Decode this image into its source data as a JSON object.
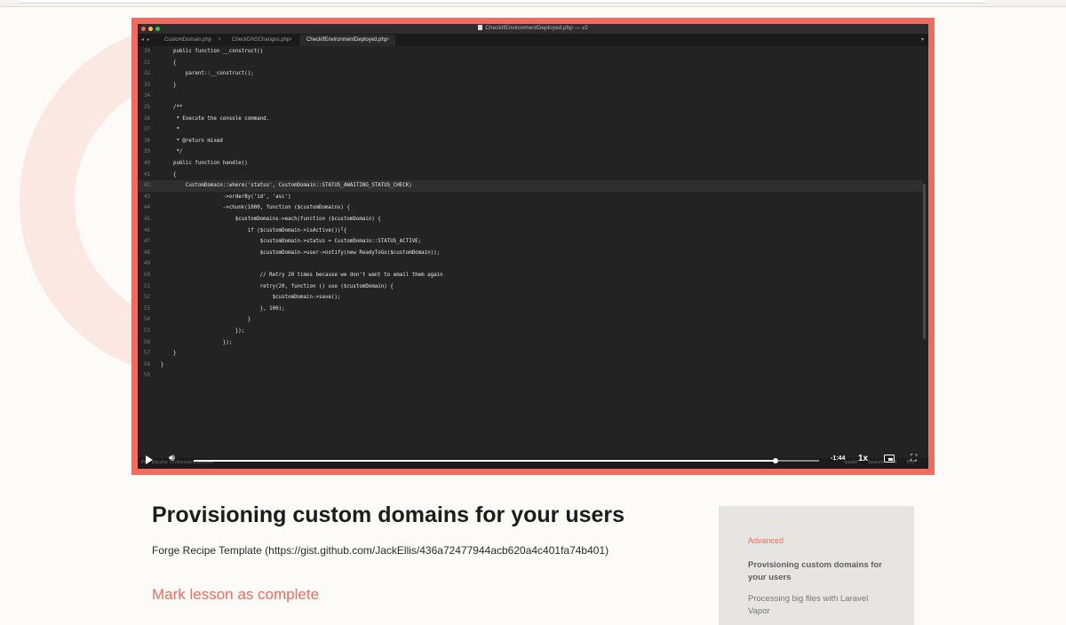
{
  "editor": {
    "title": "CheckIfEnvironmentDeployed.php — v2",
    "tabs": [
      {
        "label": "CustomDomain.php"
      },
      {
        "label": "CheckDNSChanges.php"
      },
      {
        "label": "CheckIfEnvironmentDeployed.php",
        "active": true
      }
    ],
    "code_lines": [
      {
        "n": "30",
        "text": "    public function __construct()"
      },
      {
        "n": "31",
        "text": "    {"
      },
      {
        "n": "32",
        "text": "        parent::__construct();"
      },
      {
        "n": "33",
        "text": "    }"
      },
      {
        "n": "34",
        "text": ""
      },
      {
        "n": "35",
        "text": "    /**"
      },
      {
        "n": "36",
        "text": "     * Execute the console command."
      },
      {
        "n": "37",
        "text": "     *"
      },
      {
        "n": "38",
        "text": "     * @return mixed"
      },
      {
        "n": "39",
        "text": "     */"
      },
      {
        "n": "40",
        "text": "    public function handle()"
      },
      {
        "n": "41",
        "text": "    {"
      },
      {
        "n": "42",
        "text": "        CustomDomain::where('status', CustomDomain::STATUS_AWAITING_STATUS_CHECK)"
      },
      {
        "n": "43",
        "text": "                    ->orderBy('id', 'asc')"
      },
      {
        "n": "44",
        "text": "                    ->chunk(1000, function ($customDomains) {"
      },
      {
        "n": "45",
        "text": "                        $customDomains->each(function ($customDomain) {"
      },
      {
        "n": "46",
        "text": "                            if ($customDomain->isActive()) {"
      },
      {
        "n": "47",
        "text": "                                $customDomain->status = CustomDomain::STATUS_ACTIVE;"
      },
      {
        "n": "48",
        "text": "                                $customDomain->user->notify(new ReadyToGo($customDomain));"
      },
      {
        "n": "49",
        "text": ""
      },
      {
        "n": "50",
        "text": "                                // Retry 20 times because we don't want to email them again"
      },
      {
        "n": "51",
        "text": "                                retry(20, function () use ($customDomain) {"
      },
      {
        "n": "52",
        "text": "                                    $customDomain->save();"
      },
      {
        "n": "53",
        "text": "                                }, 100);"
      },
      {
        "n": "54",
        "text": "                            }"
      },
      {
        "n": "55",
        "text": "                        });"
      },
      {
        "n": "56",
        "text": "                    });"
      },
      {
        "n": "57",
        "text": "    }"
      },
      {
        "n": "58",
        "text": "}"
      },
      {
        "n": "59",
        "text": ""
      }
    ],
    "current_line": "42",
    "status_left": "PHP  php.php  70 characters selected",
    "status_right": "master  Spaces: 4  PHP"
  },
  "player": {
    "time_remaining": "-1:44",
    "speed": "1x",
    "progress": 0.93
  },
  "lesson": {
    "title": "Provisioning custom domains for your users",
    "description": "Forge Recipe Template (https://gist.github.com/JackEllis/436a72477944acb620a4c401fa74b401)",
    "mark_complete": "Mark lesson as complete"
  },
  "sidebar": {
    "section": "Advanced",
    "items": [
      {
        "label": "Provisioning custom domains for your users",
        "current": true
      },
      {
        "label": "Processing big files with Laravel Vapor",
        "current": false
      }
    ]
  },
  "colors": {
    "accent": "#f06b5d",
    "editor_bg": "#232323",
    "sidebar_bg": "#e7e5e1",
    "page_bg": "#fcfbf7"
  }
}
